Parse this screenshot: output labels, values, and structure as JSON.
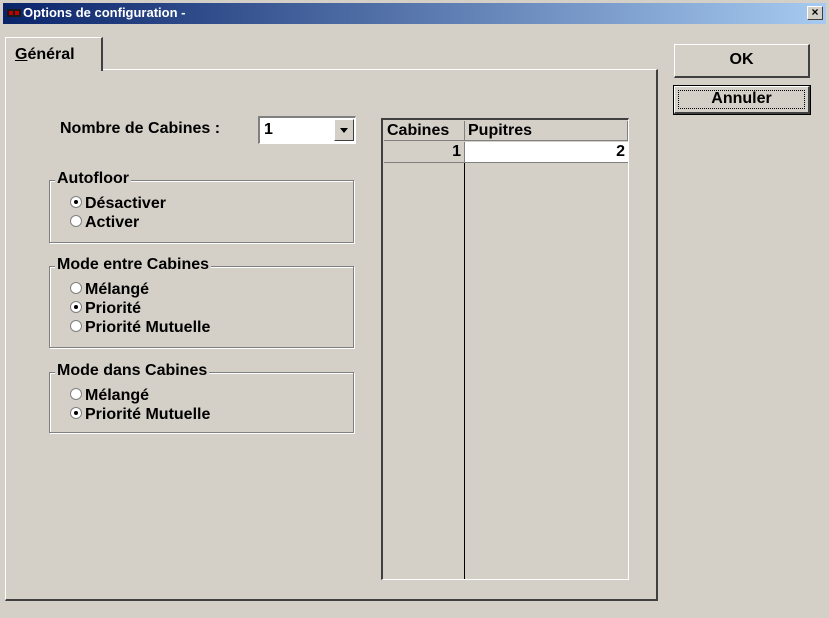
{
  "window": {
    "title": "Options de configuration -",
    "close_label": "×"
  },
  "tab": {
    "label": "Général"
  },
  "buttons": {
    "ok": "OK",
    "cancel": "Annuler"
  },
  "cabins": {
    "label": "Nombre de Cabines :",
    "selected": "1"
  },
  "autofloor": {
    "title": "Autofloor",
    "options": [
      {
        "label": "Désactiver",
        "checked": true
      },
      {
        "label": "Activer",
        "checked": false
      }
    ]
  },
  "mode_between": {
    "title": "Mode entre Cabines",
    "options": [
      {
        "label": "Mélangé",
        "checked": false
      },
      {
        "label": "Priorité",
        "checked": true
      },
      {
        "label": "Priorité Mutuelle",
        "checked": false
      }
    ]
  },
  "mode_within": {
    "title": "Mode dans Cabines",
    "options": [
      {
        "label": "Mélangé",
        "checked": false
      },
      {
        "label": "Priorité Mutuelle",
        "checked": true
      }
    ]
  },
  "table": {
    "headers": [
      "Cabines",
      "Pupitres"
    ],
    "rows": [
      [
        "1",
        "2"
      ]
    ]
  }
}
